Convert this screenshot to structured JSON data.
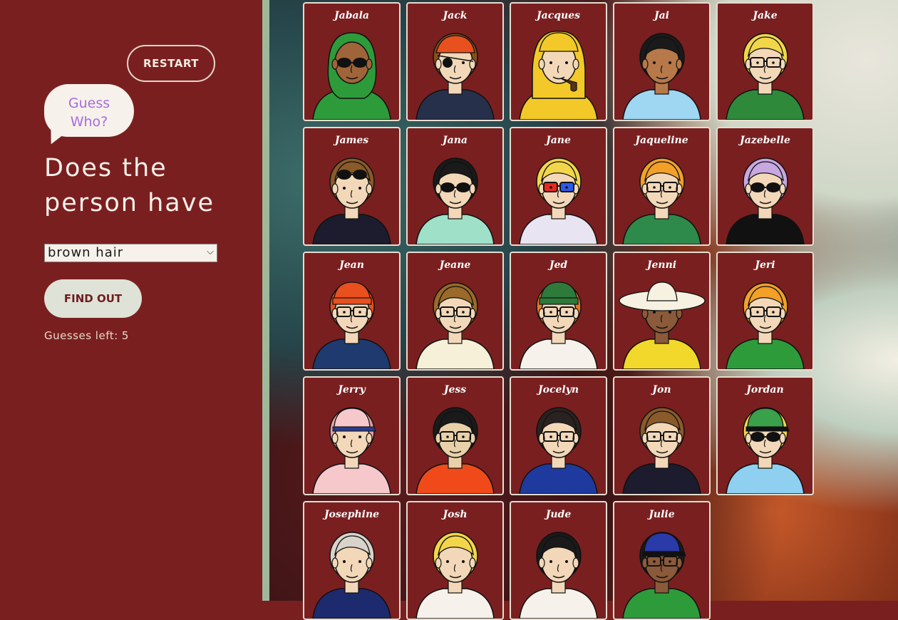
{
  "controls": {
    "restart_label": "RESTART",
    "logo_line1": "Guess",
    "logo_line2": "Who?",
    "question": "Does the person have",
    "selected_feature": "brown hair",
    "findout_label": "FIND OUT",
    "guesses_text": "Guesses left: 5"
  },
  "icons": {
    "chevron": "chevron-down-icon",
    "logo": "speech-bubble-icon"
  },
  "colors": {
    "panel_bg": "#7a1f20",
    "card_border": "#e6ddd0",
    "logo_text": "#a86be0",
    "findout_bg": "#dfe2d6"
  },
  "characters": [
    {
      "name": "Jabala",
      "skin": "#a0643a",
      "hair": "#2e9b3a",
      "shirt": "#2e9b3a",
      "acc": "sunglasses",
      "hat": "hijab"
    },
    {
      "name": "Jack",
      "skin": "#f2d8b8",
      "hair": "#8a4e1a",
      "shirt": "#27304a",
      "acc": "patch",
      "hat": "bandana"
    },
    {
      "name": "Jacques",
      "skin": "#f2d8b8",
      "hair": "#e9e4d8",
      "shirt": "#f2c928",
      "acc": "pipe",
      "hat": "raincoat"
    },
    {
      "name": "Jai",
      "skin": "#b7784a",
      "hair": "#1a1a1a",
      "shirt": "#9fd6f2",
      "acc": "none",
      "hat": "none"
    },
    {
      "name": "Jake",
      "skin": "#f2d8b8",
      "hair": "#f2d64a",
      "shirt": "#2e8a3a",
      "acc": "glasses",
      "hat": "none"
    },
    {
      "name": "James",
      "skin": "#f2d8b8",
      "hair": "#8a5a2a",
      "shirt": "#1c1c2e",
      "acc": "sunglasses-top",
      "hat": "none"
    },
    {
      "name": "Jana",
      "skin": "#f2d8b8",
      "hair": "#1a1a1a",
      "shirt": "#9fe0c8",
      "acc": "sunglasses",
      "hat": "none"
    },
    {
      "name": "Jane",
      "skin": "#f2d8b8",
      "hair": "#f2d64a",
      "shirt": "#e8e4f2",
      "acc": "3d-glasses",
      "hat": "none"
    },
    {
      "name": "Jaqueline",
      "skin": "#f2d8b8",
      "hair": "#f2a028",
      "shirt": "#2e8a4a",
      "acc": "glasses",
      "hat": "none"
    },
    {
      "name": "Jazebelle",
      "skin": "#f2d8b8",
      "hair": "#c8a8e0",
      "shirt": "#111111",
      "acc": "sunglasses",
      "hat": "none"
    },
    {
      "name": "Jean",
      "skin": "#f2d8b8",
      "hair": "#e8501e",
      "shirt": "#1e3a6e",
      "acc": "glasses",
      "hat": "beanie"
    },
    {
      "name": "Jeane",
      "skin": "#f2d8b8",
      "hair": "#9a6a2a",
      "shirt": "#f6f0d8",
      "acc": "glasses",
      "hat": "none"
    },
    {
      "name": "Jed",
      "skin": "#f2d8b8",
      "hair": "#e87a2a",
      "shirt": "#f6f1ea",
      "acc": "glasses",
      "hat": "beanie-green"
    },
    {
      "name": "Jenni",
      "skin": "#8a5a3a",
      "hair": "#f2ead8",
      "shirt": "#f2d82a",
      "acc": "none",
      "hat": "sunhat"
    },
    {
      "name": "Jeri",
      "skin": "#f2d8b8",
      "hair": "#f2a028",
      "shirt": "#2e9b3a",
      "acc": "glasses",
      "hat": "none"
    },
    {
      "name": "Jerry",
      "skin": "#f2d8b8",
      "hair": "#e8a0a8",
      "shirt": "#f6c8cc",
      "acc": "none",
      "hat": "cap"
    },
    {
      "name": "Jess",
      "skin": "#e8d0a8",
      "hair": "#1a1a1a",
      "shirt": "#f04a1a",
      "acc": "glasses",
      "hat": "none"
    },
    {
      "name": "Jocelyn",
      "skin": "#f2d8b8",
      "hair": "#2a2220",
      "shirt": "#1e3a9e",
      "acc": "glasses",
      "hat": "none"
    },
    {
      "name": "Jon",
      "skin": "#f2d8b8",
      "hair": "#8a5a2a",
      "shirt": "#1c1c2e",
      "acc": "glasses",
      "hat": "none"
    },
    {
      "name": "Jordan",
      "skin": "#f2d8b8",
      "hair": "#f2d64a",
      "shirt": "#8fd0f0",
      "acc": "sunglasses",
      "hat": "cap-green"
    },
    {
      "name": "Josephine",
      "skin": "#f2d8b8",
      "hair": "#d8d4cc",
      "shirt": "#1e2a6e",
      "acc": "none",
      "hat": "none"
    },
    {
      "name": "Josh",
      "skin": "#f2d8b8",
      "hair": "#f2d64a",
      "shirt": "#f6f1ea",
      "acc": "none",
      "hat": "none"
    },
    {
      "name": "Jude",
      "skin": "#f2d8b8",
      "hair": "#1a1a1a",
      "shirt": "#f6f1ea",
      "acc": "none",
      "hat": "none"
    },
    {
      "name": "Julie",
      "skin": "#8a5a3a",
      "hair": "#1a1a1a",
      "shirt": "#2e9b3a",
      "acc": "glasses",
      "hat": "cap-blue"
    }
  ]
}
